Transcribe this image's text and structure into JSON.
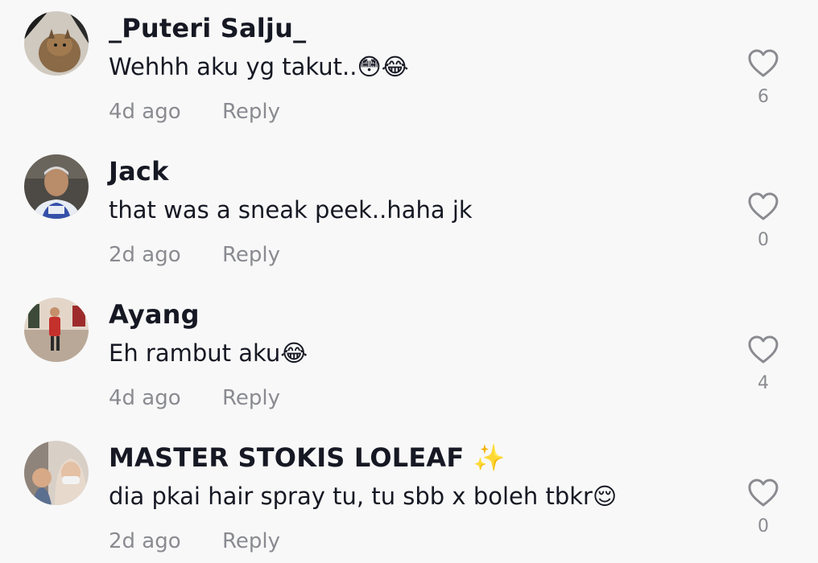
{
  "comments": [
    {
      "username": "_Puteri Salju_",
      "text": "Wehhh aku yg takut..😳😂",
      "time": "4d ago",
      "reply_label": "Reply",
      "likes": "6"
    },
    {
      "username": "Jack",
      "text": "that was a sneak peek..haha jk",
      "time": "2d ago",
      "reply_label": "Reply",
      "likes": "0"
    },
    {
      "username": "Ayang",
      "text": "Eh rambut aku😂",
      "time": "4d ago",
      "reply_label": "Reply",
      "likes": "4"
    },
    {
      "username": "MASTER STOKIS LOLEAF ✨",
      "text": "dia pkai hair spray tu, tu sbb x boleh tbkr😌",
      "time": "2d ago",
      "reply_label": "Reply",
      "likes": "0"
    }
  ],
  "icons": {
    "like": "heart-outline-icon"
  },
  "colors": {
    "background": "#f8f8f8",
    "text_primary": "#161823",
    "text_secondary": "#8a8b91"
  }
}
